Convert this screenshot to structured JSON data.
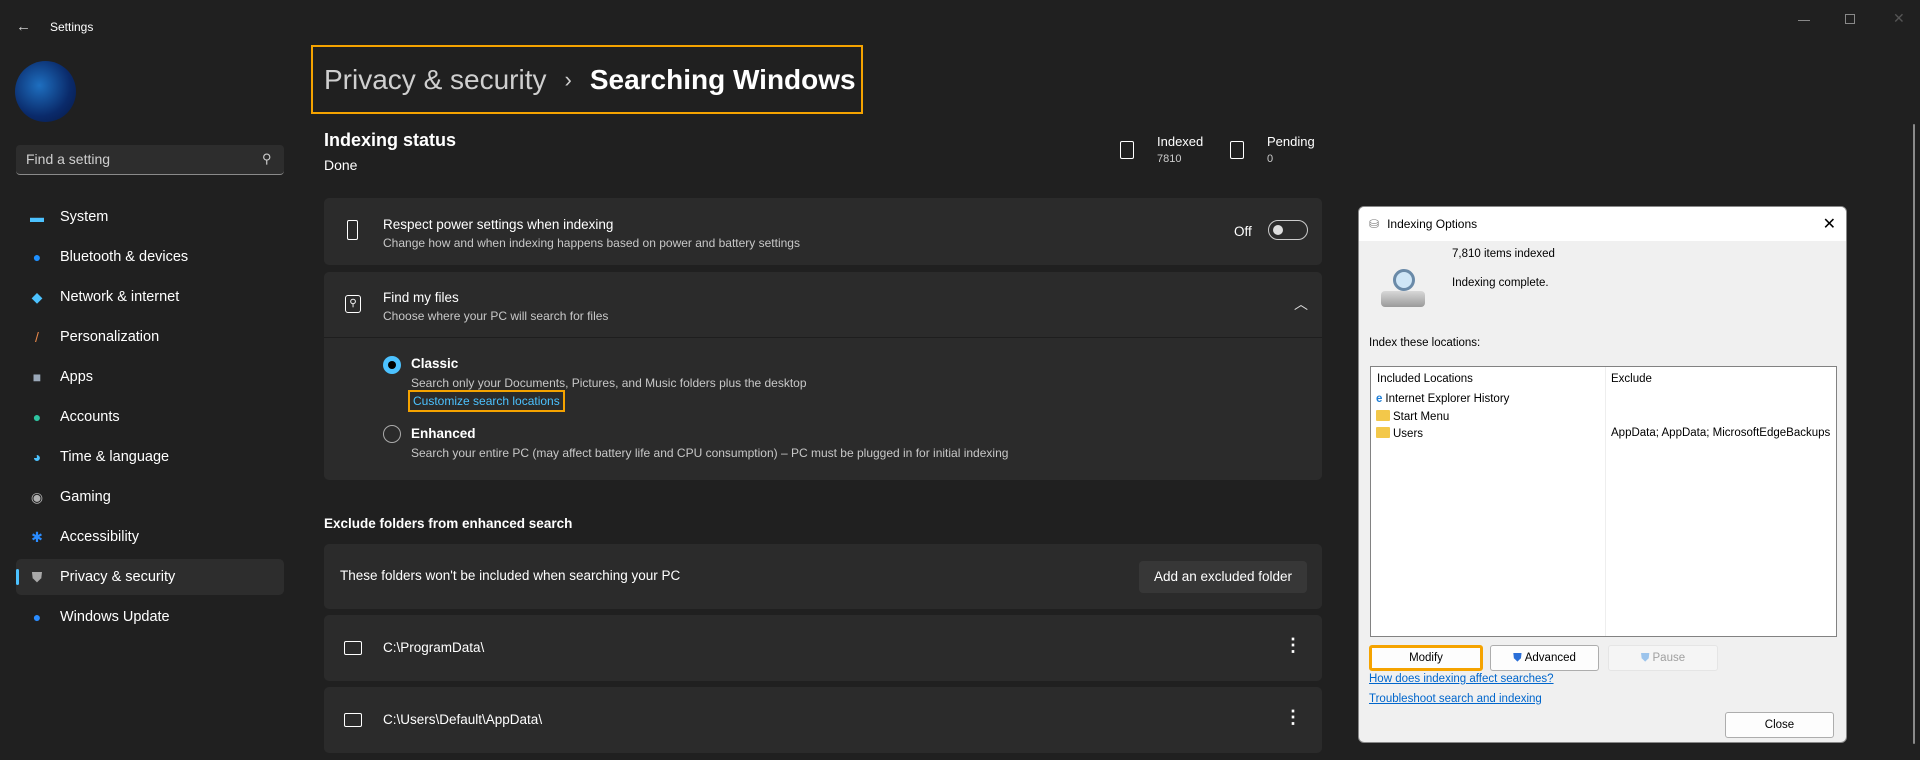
{
  "window": {
    "title": "Settings",
    "controls": [
      "minimize",
      "restore",
      "close"
    ]
  },
  "search": {
    "placeholder": "Find a setting"
  },
  "sidebar": {
    "items": [
      {
        "label": "System",
        "icon": "monitor-icon",
        "color": "#4cc2ff"
      },
      {
        "label": "Bluetooth & devices",
        "icon": "bluetooth-icon",
        "color": "#1e90ff"
      },
      {
        "label": "Network & internet",
        "icon": "wifi-icon",
        "color": "#4cc2ff"
      },
      {
        "label": "Personalization",
        "icon": "brush-icon",
        "color": "#e8884a"
      },
      {
        "label": "Apps",
        "icon": "apps-icon",
        "color": "#9aa8b8"
      },
      {
        "label": "Accounts",
        "icon": "person-icon",
        "color": "#2ec4a0"
      },
      {
        "label": "Time & language",
        "icon": "clock-globe-icon",
        "color": "#4cc2ff"
      },
      {
        "label": "Gaming",
        "icon": "gamepad-icon",
        "color": "#b0b0b0"
      },
      {
        "label": "Accessibility",
        "icon": "accessibility-icon",
        "color": "#2a8cff"
      },
      {
        "label": "Privacy & security",
        "icon": "shield-icon",
        "color": "#a8a8a8",
        "selected": true
      },
      {
        "label": "Windows Update",
        "icon": "update-icon",
        "color": "#2a8cff"
      }
    ]
  },
  "breadcrumb": {
    "parent": "Privacy & security",
    "separator": "›",
    "current": "Searching Windows"
  },
  "status": {
    "title": "Indexing status",
    "value": "Done",
    "indexed_label": "Indexed",
    "indexed_value": "7810",
    "pending_label": "Pending",
    "pending_value": "0"
  },
  "power": {
    "title": "Respect power settings when indexing",
    "desc": "Change how and when indexing happens based on power and battery settings",
    "toggle_label": "Off",
    "toggle_on": false
  },
  "findfiles": {
    "title": "Find my files",
    "desc": "Choose where your PC will search for files",
    "classic": {
      "label": "Classic",
      "desc": "Search only your Documents, Pictures, and Music folders plus the desktop",
      "link": "Customize search locations",
      "selected": true
    },
    "enhanced": {
      "label": "Enhanced",
      "desc": "Search your entire PC (may affect battery life and CPU consumption) – PC must be plugged in for initial indexing",
      "selected": false
    }
  },
  "exclude": {
    "heading": "Exclude folders from enhanced search",
    "desc": "These folders won't be included when searching your PC",
    "add_button": "Add an excluded folder",
    "folders": [
      "C:\\ProgramData\\",
      "C:\\Users\\Default\\AppData\\"
    ]
  },
  "dialog": {
    "title": "Indexing Options",
    "count": "7,810 items indexed",
    "state": "Indexing complete.",
    "locations_label": "Index these locations:",
    "col_included": "Included Locations",
    "col_exclude": "Exclude",
    "rows": [
      {
        "name": "Internet Explorer History",
        "icon": "ie-icon",
        "exclude": ""
      },
      {
        "name": "Start Menu",
        "icon": "folder-icon",
        "exclude": ""
      },
      {
        "name": "Users",
        "icon": "folder-icon",
        "exclude": "AppData; AppData; MicrosoftEdgeBackups"
      }
    ],
    "modify": "Modify",
    "advanced": "Advanced",
    "pause": "Pause",
    "link1": "How does indexing affect searches?",
    "link2": "Troubleshoot search and indexing",
    "close": "Close"
  },
  "colors": {
    "accent": "#4cc2ff",
    "highlight": "#f5a300",
    "background": "#202020",
    "card": "#2b2b2b"
  }
}
